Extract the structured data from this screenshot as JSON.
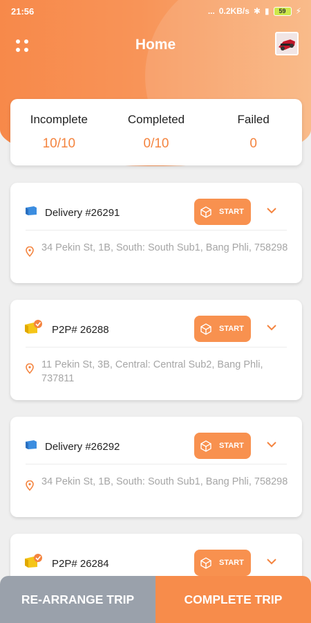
{
  "status_bar": {
    "time": "21:56",
    "dots": "...",
    "network_speed": "0.2KB/s",
    "battery": "59"
  },
  "app_bar": {
    "title": "Home"
  },
  "stats": [
    {
      "label": "Incomplete",
      "value": "10/10"
    },
    {
      "label": "Completed",
      "value": "0/10"
    },
    {
      "label": "Failed",
      "value": "0"
    }
  ],
  "jobs": [
    {
      "type": "delivery",
      "name": "Delivery #26291",
      "button": "START",
      "address": "34 Pekin St, 1B, South:  South Sub1, Bang Phli, 758298"
    },
    {
      "type": "p2p",
      "name": "P2P# 26288",
      "button": "START",
      "address": "11 Pekin St, 3B, Central:  Central Sub2, Bang Phli, 737811"
    },
    {
      "type": "delivery",
      "name": "Delivery #26292",
      "button": "START",
      "address": "34 Pekin St, 1B, South:  South Sub1, Bang Phli, 758298"
    },
    {
      "type": "p2p",
      "name": "P2P# 26284",
      "button": "START",
      "address": ""
    }
  ],
  "bottom_bar": {
    "rearrange_label": "RE-ARRANGE TRIP",
    "complete_label": "COMPLETE TRIP"
  },
  "colors": {
    "accent": "#f78c4b",
    "secondary_button": "#9aa1ab",
    "delivery_icon": "#3b8de0",
    "p2p_icon": "#f5c518"
  }
}
